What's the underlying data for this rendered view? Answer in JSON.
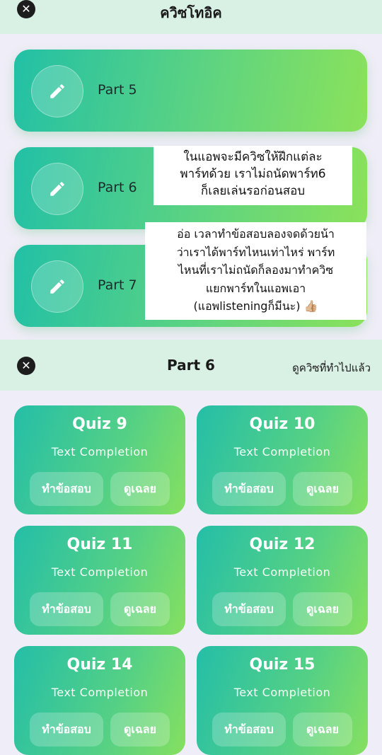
{
  "top_title": "ควิซโทอิค",
  "parts": [
    {
      "label": "Part 5"
    },
    {
      "label": "Part 6"
    },
    {
      "label": "Part 7"
    }
  ],
  "notes": {
    "note1": [
      "ในแอพจะมีควิซให้ฝึกแต่ละ",
      "พาร์ทด้วย เราไม่ถนัดพาร์ท6",
      "ก็เลยเล่นรอก่อนสอบ"
    ],
    "note2": [
      "อ่อ เวลาทำข้อสอบลองจดด้วยน้า",
      "ว่าเราได้พาร์ทไหนเท่าไหร่ พาร์ท",
      "ไหนที่เราไม่ถนัดก็ลองมาทำควิซ",
      "แยกพาร์ทในแอพเอา",
      "(แอพlisteningก็มีนะ) 👍🏼"
    ]
  },
  "section": {
    "title": "Part 6",
    "link": "ดูควิซที่ทำไปแล้ว"
  },
  "quizzes": [
    {
      "title": "Quiz 9",
      "subtitle": "Text Completion",
      "take": "ทำข้อสอบ",
      "answers": "ดูเฉลย"
    },
    {
      "title": "Quiz 10",
      "subtitle": "Text Completion",
      "take": "ทำข้อสอบ",
      "answers": "ดูเฉลย"
    },
    {
      "title": "Quiz 11",
      "subtitle": "Text Completion",
      "take": "ทำข้อสอบ",
      "answers": "ดูเฉลย"
    },
    {
      "title": "Quiz 12",
      "subtitle": "Text Completion",
      "take": "ทำข้อสอบ",
      "answers": "ดูเฉลย"
    },
    {
      "title": "Quiz 14",
      "subtitle": "Text Completion",
      "take": "ทำข้อสอบ",
      "answers": "ดูเฉลย"
    },
    {
      "title": "Quiz 15",
      "subtitle": "Text Completion",
      "take": "ทำข้อสอบ",
      "answers": "ดูเฉลย"
    }
  ],
  "icons": {
    "close": "close-icon",
    "edit": "pencil-icon"
  }
}
